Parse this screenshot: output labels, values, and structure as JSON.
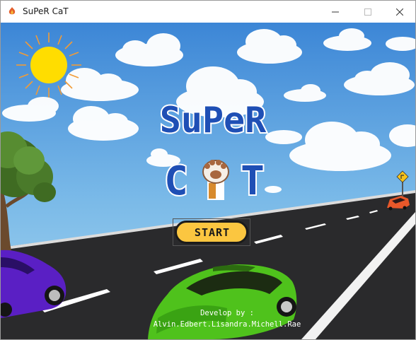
{
  "window": {
    "title": "SuPeR CaT",
    "minimize_symbol": "—",
    "close_symbol": "✕"
  },
  "game": {
    "logo_line1": "SuPeR",
    "logo_line2_left": "C",
    "logo_line2_right": "T",
    "start_label": "START",
    "credits_line1": "Develop by :",
    "credits_line2": "Alvin.Edbert.Lisandra.Michell.Rae"
  },
  "icons": [
    "app-icon",
    "minimize-icon",
    "maximize-icon",
    "close-icon",
    "sun-icon",
    "cat-paw-icon",
    "road-sign-icon"
  ],
  "colors": {
    "sky_top": "#3c86d6",
    "sky_bottom": "#9fd2ec",
    "logo_blue": "#1f4fb5",
    "button_yellow": "#fbc640",
    "road": "#2b2b2b",
    "green_car": "#4fc21c",
    "purple_car": "#5a1fc4",
    "orange_car": "#e8582a"
  }
}
